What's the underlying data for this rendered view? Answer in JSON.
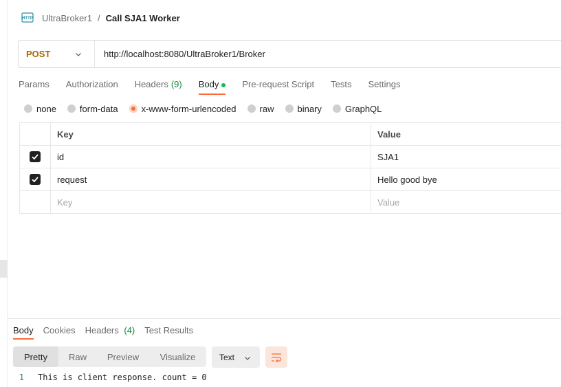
{
  "breadcrumb": {
    "icon": "http-request-icon",
    "parent": "UltraBroker1",
    "separator": "/",
    "current": "Call SJA1 Worker"
  },
  "request": {
    "method": "POST",
    "url": "http://localhost:8080/UltraBroker1/Broker"
  },
  "request_tabs": [
    {
      "label": "Params",
      "active": false
    },
    {
      "label": "Authorization",
      "active": false
    },
    {
      "label": "Headers",
      "count": "(9)",
      "active": false
    },
    {
      "label": "Body",
      "active": true,
      "indicator_color": "#0cbb52"
    },
    {
      "label": "Pre-request Script",
      "active": false
    },
    {
      "label": "Tests",
      "active": false
    },
    {
      "label": "Settings",
      "active": false
    }
  ],
  "body_types": [
    {
      "label": "none",
      "selected": false
    },
    {
      "label": "form-data",
      "selected": false
    },
    {
      "label": "x-www-form-urlencoded",
      "selected": true
    },
    {
      "label": "raw",
      "selected": false
    },
    {
      "label": "binary",
      "selected": false
    },
    {
      "label": "GraphQL",
      "selected": false
    }
  ],
  "params_table": {
    "headers": {
      "key": "Key",
      "value": "Value"
    },
    "rows": [
      {
        "checked": true,
        "key": "id",
        "value": "SJA1"
      },
      {
        "checked": true,
        "key": "request",
        "value": "Hello good bye"
      }
    ],
    "placeholder": {
      "key": "Key",
      "value": "Value"
    }
  },
  "response_tabs": [
    {
      "label": "Body",
      "active": true
    },
    {
      "label": "Cookies",
      "active": false
    },
    {
      "label": "Headers",
      "count": "(4)",
      "active": false
    },
    {
      "label": "Test Results",
      "active": false
    }
  ],
  "view_modes": [
    {
      "label": "Pretty",
      "active": true
    },
    {
      "label": "Raw",
      "active": false
    },
    {
      "label": "Preview",
      "active": false
    },
    {
      "label": "Visualize",
      "active": false
    }
  ],
  "format": "Text",
  "wrap_icon": "wrap-lines-icon",
  "response_lines": [
    {
      "number": "1",
      "text": "This is client response. count = 0"
    }
  ],
  "colors": {
    "accent": "#ff6c37",
    "method_post": "#a36a00",
    "count_green": "#0f8a3c"
  }
}
